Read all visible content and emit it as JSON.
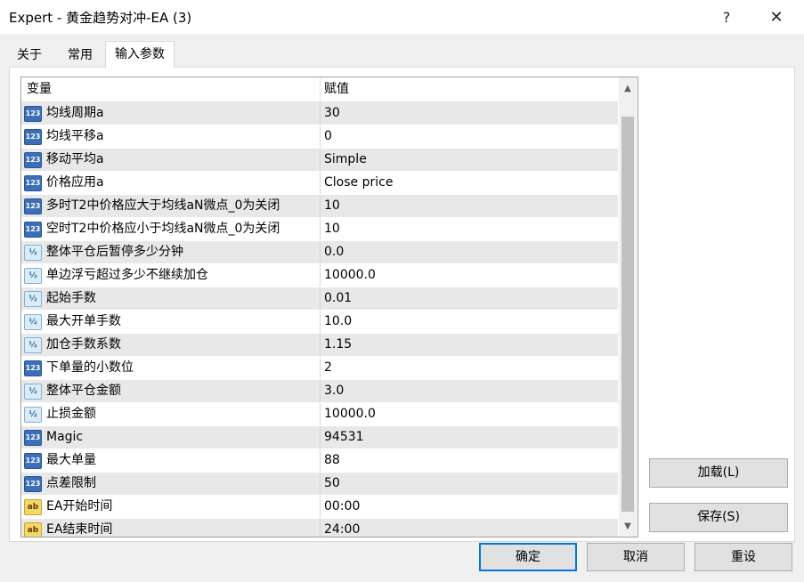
{
  "window": {
    "title": "Expert - 黄金趋势对冲-EA (3)",
    "help_glyph": "?",
    "close_glyph": "✕"
  },
  "tabs": [
    {
      "label": "关于",
      "active": false
    },
    {
      "label": "常用",
      "active": false
    },
    {
      "label": "输入参数",
      "active": true
    }
  ],
  "table": {
    "headers": {
      "variable": "变量",
      "value": "赋值"
    },
    "rows": [
      {
        "icon": "int-icon",
        "icon_text": "123",
        "name": "均线周期a",
        "value": "30"
      },
      {
        "icon": "int-icon",
        "icon_text": "123",
        "name": "均线平移a",
        "value": "0"
      },
      {
        "icon": "int-icon",
        "icon_text": "123",
        "name": "移动平均a",
        "value": "Simple"
      },
      {
        "icon": "int-icon",
        "icon_text": "123",
        "name": "价格应用a",
        "value": "Close price"
      },
      {
        "icon": "int-icon",
        "icon_text": "123",
        "name": "多时T2中价格应大于均线aN微点_0为关闭",
        "value": "10"
      },
      {
        "icon": "int-icon",
        "icon_text": "123",
        "name": "空时T2中价格应小于均线aN微点_0为关闭",
        "value": "10"
      },
      {
        "icon": "double-icon",
        "icon_text": "½",
        "name": "整体平仓后暂停多少分钟",
        "value": "0.0"
      },
      {
        "icon": "double-icon",
        "icon_text": "½",
        "name": "单边浮亏超过多少不继续加仓",
        "value": "10000.0"
      },
      {
        "icon": "double-icon",
        "icon_text": "½",
        "name": "起始手数",
        "value": "0.01"
      },
      {
        "icon": "double-icon",
        "icon_text": "½",
        "name": "最大开单手数",
        "value": "10.0"
      },
      {
        "icon": "double-icon",
        "icon_text": "½",
        "name": "加仓手数系数",
        "value": "1.15"
      },
      {
        "icon": "int-icon",
        "icon_text": "123",
        "name": "下单量的小数位",
        "value": "2"
      },
      {
        "icon": "double-icon",
        "icon_text": "½",
        "name": "整体平仓金额",
        "value": "3.0"
      },
      {
        "icon": "double-icon",
        "icon_text": "½",
        "name": "止损金额",
        "value": "10000.0"
      },
      {
        "icon": "int-icon",
        "icon_text": "123",
        "name": "Magic",
        "value": "94531"
      },
      {
        "icon": "int-icon",
        "icon_text": "123",
        "name": "最大单量",
        "value": "88"
      },
      {
        "icon": "int-icon",
        "icon_text": "123",
        "name": "点差限制",
        "value": "50"
      },
      {
        "icon": "string-icon",
        "icon_text": "ab",
        "name": "EA开始时间",
        "value": "00:00"
      },
      {
        "icon": "string-icon",
        "icon_text": "ab",
        "name": "EA结束时间",
        "value": "24:00"
      }
    ]
  },
  "buttons": {
    "load": "加载(L)",
    "save": "保存(S)",
    "ok": "确定",
    "cancel": "取消",
    "reset": "重设"
  },
  "scrollbar": {
    "up_glyph": "▲",
    "down_glyph": "▼"
  },
  "colors": {
    "alt_row": "#e8e8e8",
    "default_button_border": "#0078d7",
    "int_icon": "#3d6fb8",
    "string_icon": "#f5d66a"
  }
}
